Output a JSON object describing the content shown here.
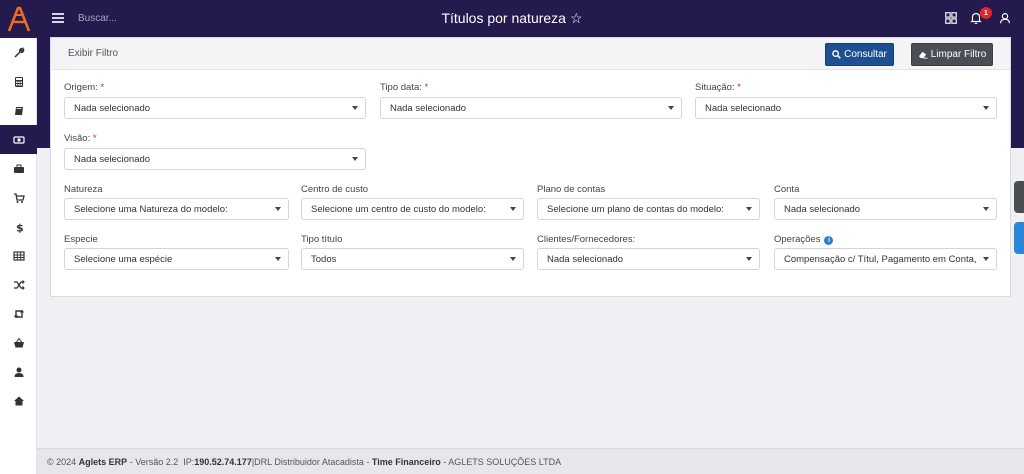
{
  "header": {
    "search_placeholder": "Buscar...",
    "title": "Títulos por natureza",
    "notifications_count": "1"
  },
  "sidebar": {
    "items": [
      {
        "icon": "wrench-icon"
      },
      {
        "icon": "calculator-icon"
      },
      {
        "icon": "book-icon"
      },
      {
        "icon": "money-icon",
        "active": true
      },
      {
        "icon": "briefcase-icon"
      },
      {
        "icon": "cart-icon"
      },
      {
        "icon": "dollar-icon"
      },
      {
        "icon": "table-icon"
      },
      {
        "icon": "shuffle-icon"
      },
      {
        "icon": "retweet-icon"
      },
      {
        "icon": "basket-icon"
      },
      {
        "icon": "user-icon"
      },
      {
        "icon": "home-icon"
      }
    ]
  },
  "filter": {
    "header_label": "Exibir Filtro",
    "consultar_label": "Consultar",
    "limpar_label": "Limpar Filtro",
    "origem": {
      "label": "Origem:",
      "value": "Nada selecionado"
    },
    "tipo_data": {
      "label": "Tipo data:",
      "value": "Nada selecionado"
    },
    "situacao": {
      "label": "Situação:",
      "value": "Nada selecionado"
    },
    "visao": {
      "label": "Visão:",
      "value": "Nada selecionado"
    },
    "natureza": {
      "label": "Natureza",
      "value": "Selecione uma Natureza do modelo:"
    },
    "centro_custo": {
      "label": "Centro de custo",
      "value": "Selecione um centro de custo do modelo:"
    },
    "plano_contas": {
      "label": "Plano de contas",
      "value": "Selecione um plano de contas do modelo:"
    },
    "conta": {
      "label": "Conta",
      "value": "Nada selecionado"
    },
    "especie": {
      "label": "Especie",
      "value": "Selecione uma espécie"
    },
    "tipo_titulo": {
      "label": "Tipo título",
      "value": "Todos"
    },
    "clientes": {
      "label": "Clientes/Fornecedores:",
      "value": "Nada selecionado"
    },
    "operacoes": {
      "label": "Operações",
      "value": "Compensação c/ Títul, Pagamento em Conta, Rec"
    },
    "required_mark": "*",
    "info_mark": "i"
  },
  "footer": {
    "copyright": "© 2024",
    "app": "Aglets ERP",
    "version": "- Versão 2.2",
    "ip_label": "IP:",
    "ip": "190.52.74.177",
    "company": "|DRL Distribuidor Atacadista -",
    "module": "Time Financeiro",
    "owner": "- AGLETS SOLUÇÕES LTDA"
  },
  "colors": {
    "topbar": "#241a4d",
    "primary_button": "#1d4f91",
    "danger_badge": "#e3262c",
    "required": "#d61f26"
  }
}
